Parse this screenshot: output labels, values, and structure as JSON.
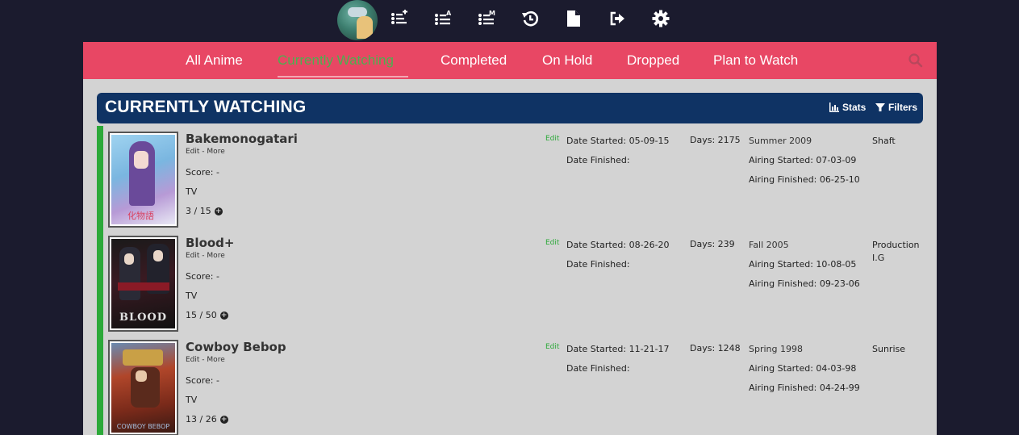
{
  "topbar": {
    "icons": [
      {
        "name": "list-add-icon"
      },
      {
        "name": "list-alpha-icon"
      },
      {
        "name": "list-manga-icon"
      },
      {
        "name": "history-icon"
      },
      {
        "name": "file-icon"
      },
      {
        "name": "logout-icon"
      },
      {
        "name": "gear-icon"
      }
    ]
  },
  "nav": {
    "tabs": [
      {
        "label": "All Anime"
      },
      {
        "label": "Currently Watching",
        "active": true
      },
      {
        "label": "Completed"
      },
      {
        "label": "On Hold"
      },
      {
        "label": "Dropped"
      },
      {
        "label": "Plan to Watch"
      }
    ]
  },
  "list": {
    "title": "CURRENTLY WATCHING",
    "stats_label": "Stats",
    "filters_label": "Filters",
    "status_color": "#2ca939",
    "items": [
      {
        "title": "Bakemonogatari",
        "edit": "Edit",
        "more": "More",
        "score": "Score: -",
        "type": "TV",
        "progress": "3 / 15",
        "edit_link": "Edit",
        "date_started": "Date Started: 05-09-15",
        "date_finished": "Date Finished:",
        "days": "Days: 2175",
        "season": "Summer 2009",
        "airing_started": "Airing Started: 07-03-09",
        "airing_finished": "Airing Finished: 06-25-10",
        "studio": "Shaft"
      },
      {
        "title": "Blood+",
        "edit": "Edit",
        "more": "More",
        "score": "Score: -",
        "type": "TV",
        "progress": "15 / 50",
        "edit_link": "Edit",
        "date_started": "Date Started: 08-26-20",
        "date_finished": "Date Finished:",
        "days": "Days: 239",
        "season": "Fall 2005",
        "airing_started": "Airing Started: 10-08-05",
        "airing_finished": "Airing Finished: 09-23-06",
        "studio": "Production I.G"
      },
      {
        "title": "Cowboy Bebop",
        "edit": "Edit",
        "more": "More",
        "score": "Score: -",
        "type": "TV",
        "progress": "13 / 26",
        "edit_link": "Edit",
        "date_started": "Date Started: 11-21-17",
        "date_finished": "Date Finished:",
        "days": "Days: 1248",
        "season": "Spring 1998",
        "airing_started": "Airing Started: 04-03-98",
        "airing_finished": "Airing Finished: 04-24-99",
        "studio": "Sunrise"
      }
    ]
  },
  "colors": {
    "page_bg": "#1b1b2e",
    "nav_bg": "#e84764",
    "active_tab": "#4caf50",
    "header_bg": "#0f3364",
    "content_bg": "#d3d3d3"
  }
}
